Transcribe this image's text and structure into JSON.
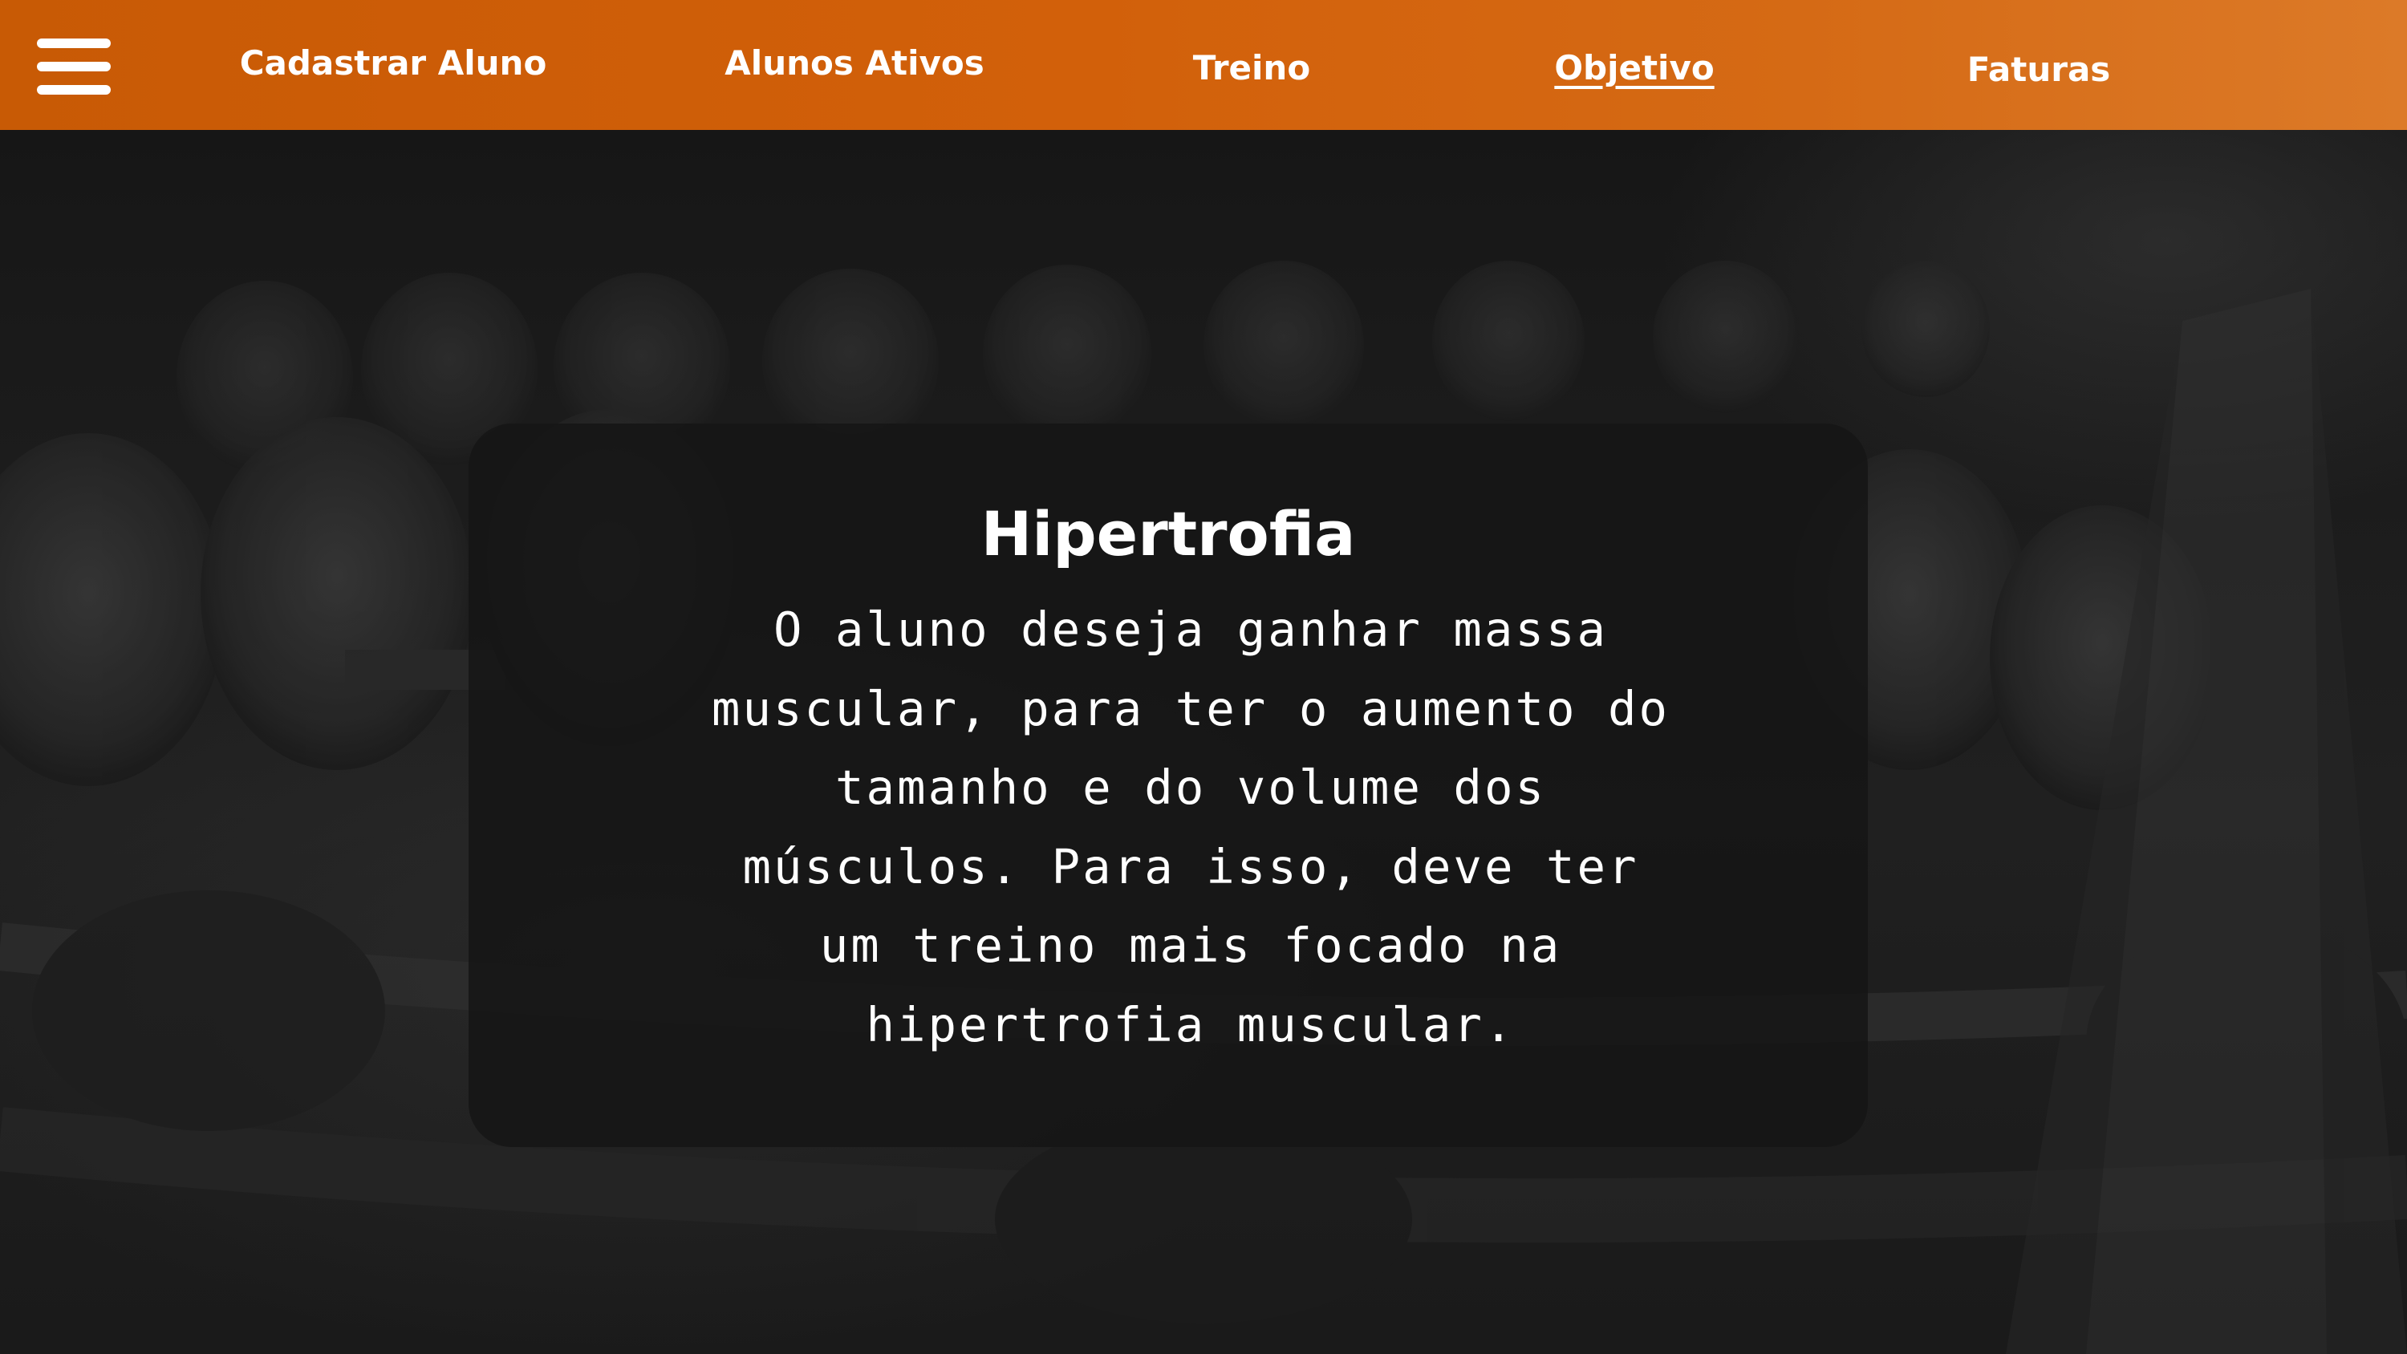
{
  "colors": {
    "navbar_accent": "#d2600a",
    "text": "#ffffff",
    "card_background": "#161616"
  },
  "navbar": {
    "menu_icon": "hamburger-menu-icon",
    "links": [
      {
        "label": "Cadastrar Aluno",
        "active": false
      },
      {
        "label": "Alunos Ativos",
        "active": false
      },
      {
        "label": "Treino",
        "active": false
      },
      {
        "label": "Objetivo",
        "active": true
      },
      {
        "label": "Faturas",
        "active": false
      }
    ]
  },
  "objective_card": {
    "title": "Hipertrofia",
    "description": "O aluno deseja ganhar massa muscular, para ter o aumento do tamanho e do volume dos músculos. Para isso,  deve ter um treino mais focado na hipertrofia muscular."
  }
}
